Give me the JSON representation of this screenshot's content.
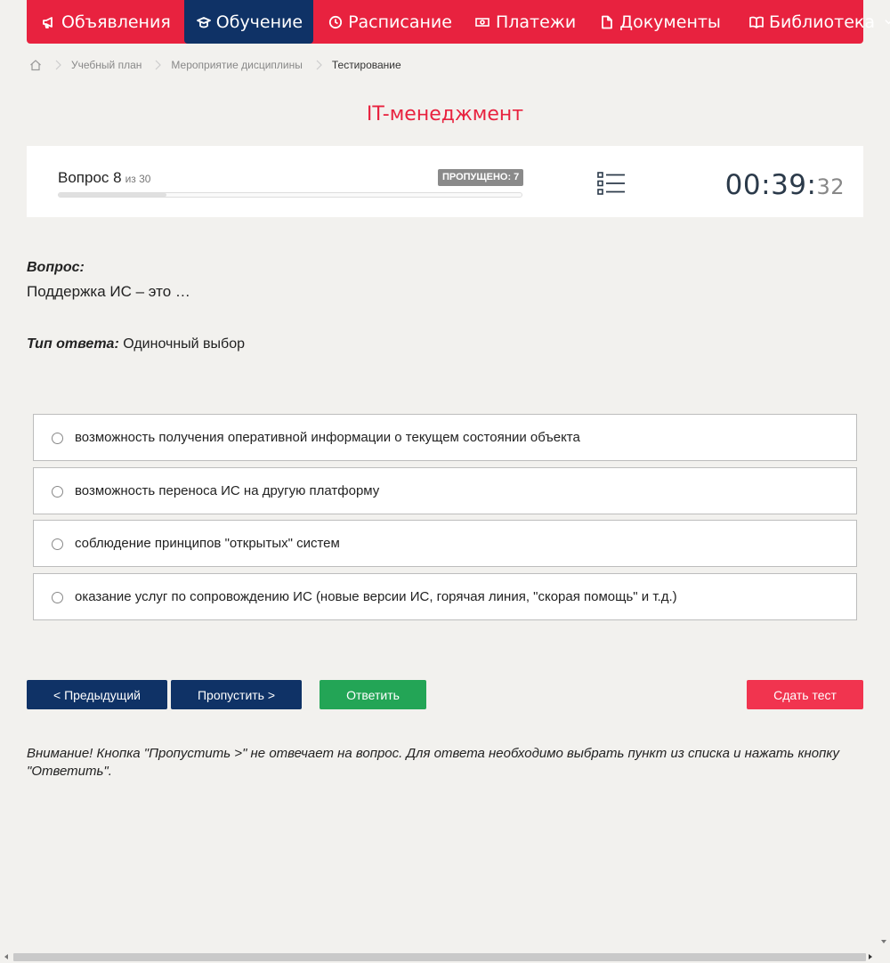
{
  "nav": {
    "items": [
      {
        "label": "Объявления",
        "icon": "megaphone-icon"
      },
      {
        "label": "Обучение",
        "icon": "graduation-cap-icon",
        "active": true
      },
      {
        "label": "Расписание",
        "icon": "clock-icon"
      },
      {
        "label": "Платежи",
        "icon": "money-bill-icon"
      },
      {
        "label": "Документы",
        "icon": "document-icon"
      },
      {
        "label": "Библиотека",
        "icon": "book-icon",
        "dropdown": true
      }
    ]
  },
  "breadcrumb": {
    "home_icon": "home-icon",
    "items": [
      "Учебный план",
      "Мероприятие дисциплины",
      "Тестирование"
    ]
  },
  "page": {
    "title": "IT-менеджмент"
  },
  "question_panel": {
    "question_label": "Вопрос 8",
    "of_label": "из 30",
    "current": 8,
    "total": 30,
    "skipped_badge": "ПРОПУЩЕНО: 7",
    "list_icon": "list-icon",
    "timer": {
      "hm": "00:39:",
      "seconds": "32"
    }
  },
  "question": {
    "label": "Вопрос:",
    "text": "Поддержка ИС – это …",
    "answer_type_label": "Тип ответа:",
    "answer_type_value": "Одиночный выбор"
  },
  "options": [
    "возможность получения оперативной информации о текущем состоянии объекта",
    "возможность переноса ИС на другую платформу",
    "соблюдение принципов \"открытых\" систем",
    "оказание услуг по сопровождению ИС (новые версии ИС, горячая линия, \"скорая помощь\" и т.д.)"
  ],
  "buttons": {
    "prev": "< Предыдущий",
    "skip": "Пропустить >",
    "answer": "Ответить",
    "submit": "Сдать тест"
  },
  "notice": "Внимание! Кнопка \"Пропустить >\" не отвечает на вопрос. Для ответа необходимо выбрать пункт из списка и нажать кнопку \"Ответить\".",
  "colors": {
    "brand_red": "#e8223f",
    "navy": "#0f3266",
    "green": "#23a556",
    "submit_red": "#f1344f"
  }
}
